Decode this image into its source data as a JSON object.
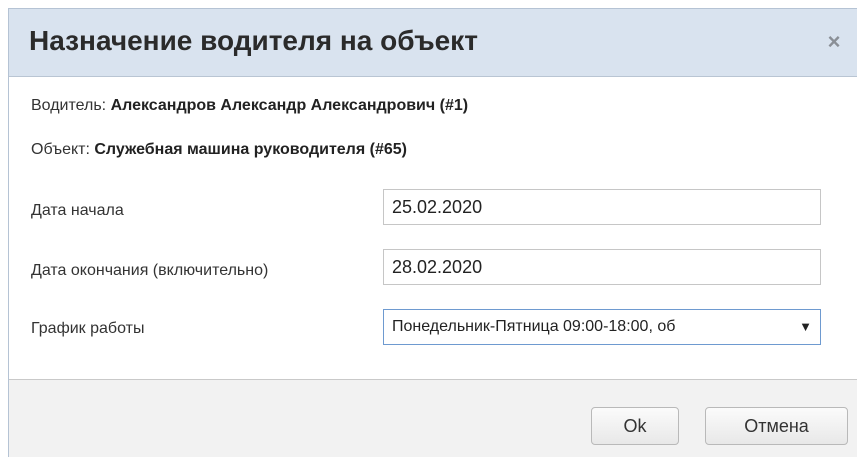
{
  "dialog": {
    "title": "Назначение водителя на объект",
    "close_glyph": "×"
  },
  "driver": {
    "label": "Водитель: ",
    "value": "Александров Александр Александрович (#1)"
  },
  "object": {
    "label": "Объект: ",
    "value": "Служебная машина руководителя (#65)"
  },
  "fields": {
    "start_date": {
      "label": "Дата начала",
      "value": "25.02.2020"
    },
    "end_date": {
      "label": "Дата окончания (включительно)",
      "value": "28.02.2020"
    },
    "schedule": {
      "label": "График работы",
      "selected": "Понедельник-Пятница 09:00-18:00, об",
      "arrow": "▼"
    }
  },
  "buttons": {
    "ok_label": "Ok",
    "cancel_label": "Отмена"
  },
  "icons": {
    "close": "close-icon",
    "dropdown": "chevron-down-icon"
  }
}
